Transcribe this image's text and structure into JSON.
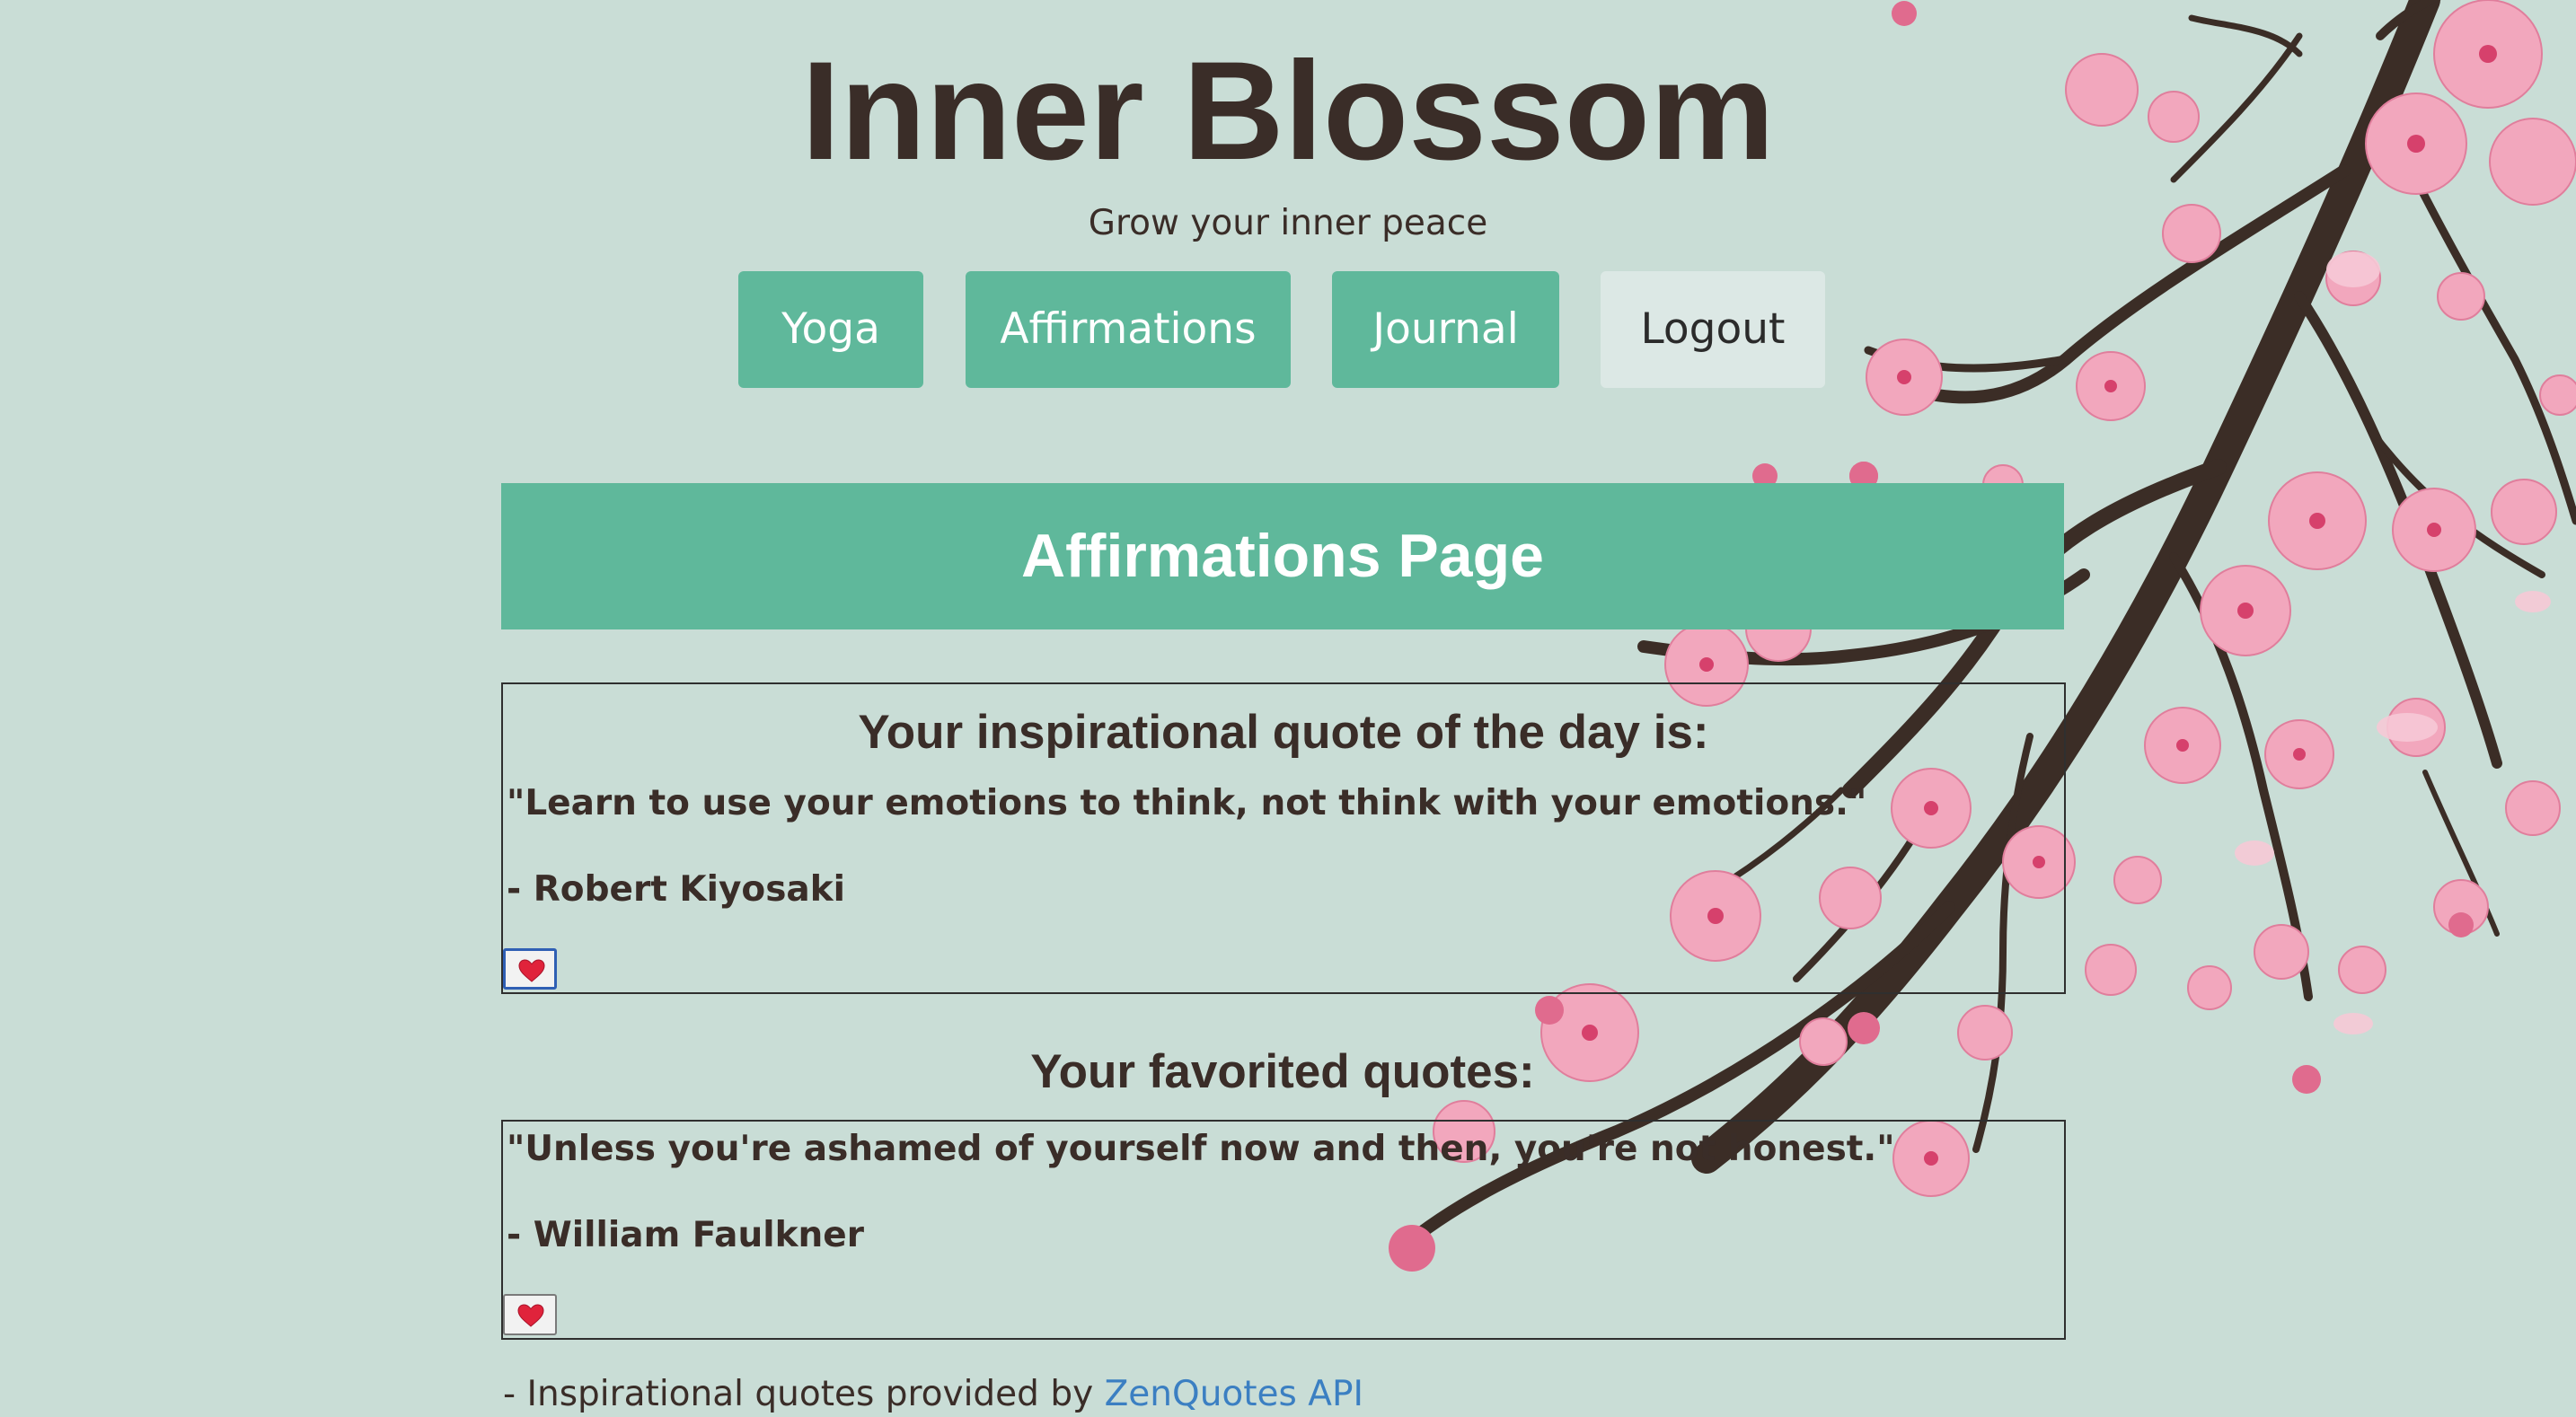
{
  "app": {
    "title": "Inner Blossom",
    "tagline": "Grow your inner peace"
  },
  "nav": {
    "items": [
      {
        "label": "Yoga"
      },
      {
        "label": "Affirmations"
      },
      {
        "label": "Journal"
      },
      {
        "label": "Logout"
      }
    ]
  },
  "page": {
    "header": "Affirmations Page"
  },
  "quote_of_day": {
    "heading": "Your inspirational quote of the day is:",
    "text": "\"Learn to use your emotions to think, not think with your emotions.\"",
    "author": "- Robert Kiyosaki",
    "favorite_icon": "heart-icon"
  },
  "favorites": {
    "heading": "Your favorited quotes:",
    "items": [
      {
        "text": "\"Unless you're ashamed of yourself now and then, you're not honest.\"",
        "author": "- William Faulkner",
        "favorite_icon": "heart-icon"
      }
    ]
  },
  "footer": {
    "credit_prefix": "- Inspirational quotes provided by",
    "credit_link": "ZenQuotes API"
  },
  "colors": {
    "background": "#c9ddd6",
    "accent": "#5fb89b",
    "text": "#3a2d28",
    "link": "#3b7fc2",
    "blossom": "#f2a7bd",
    "branch": "#3b2d26"
  }
}
